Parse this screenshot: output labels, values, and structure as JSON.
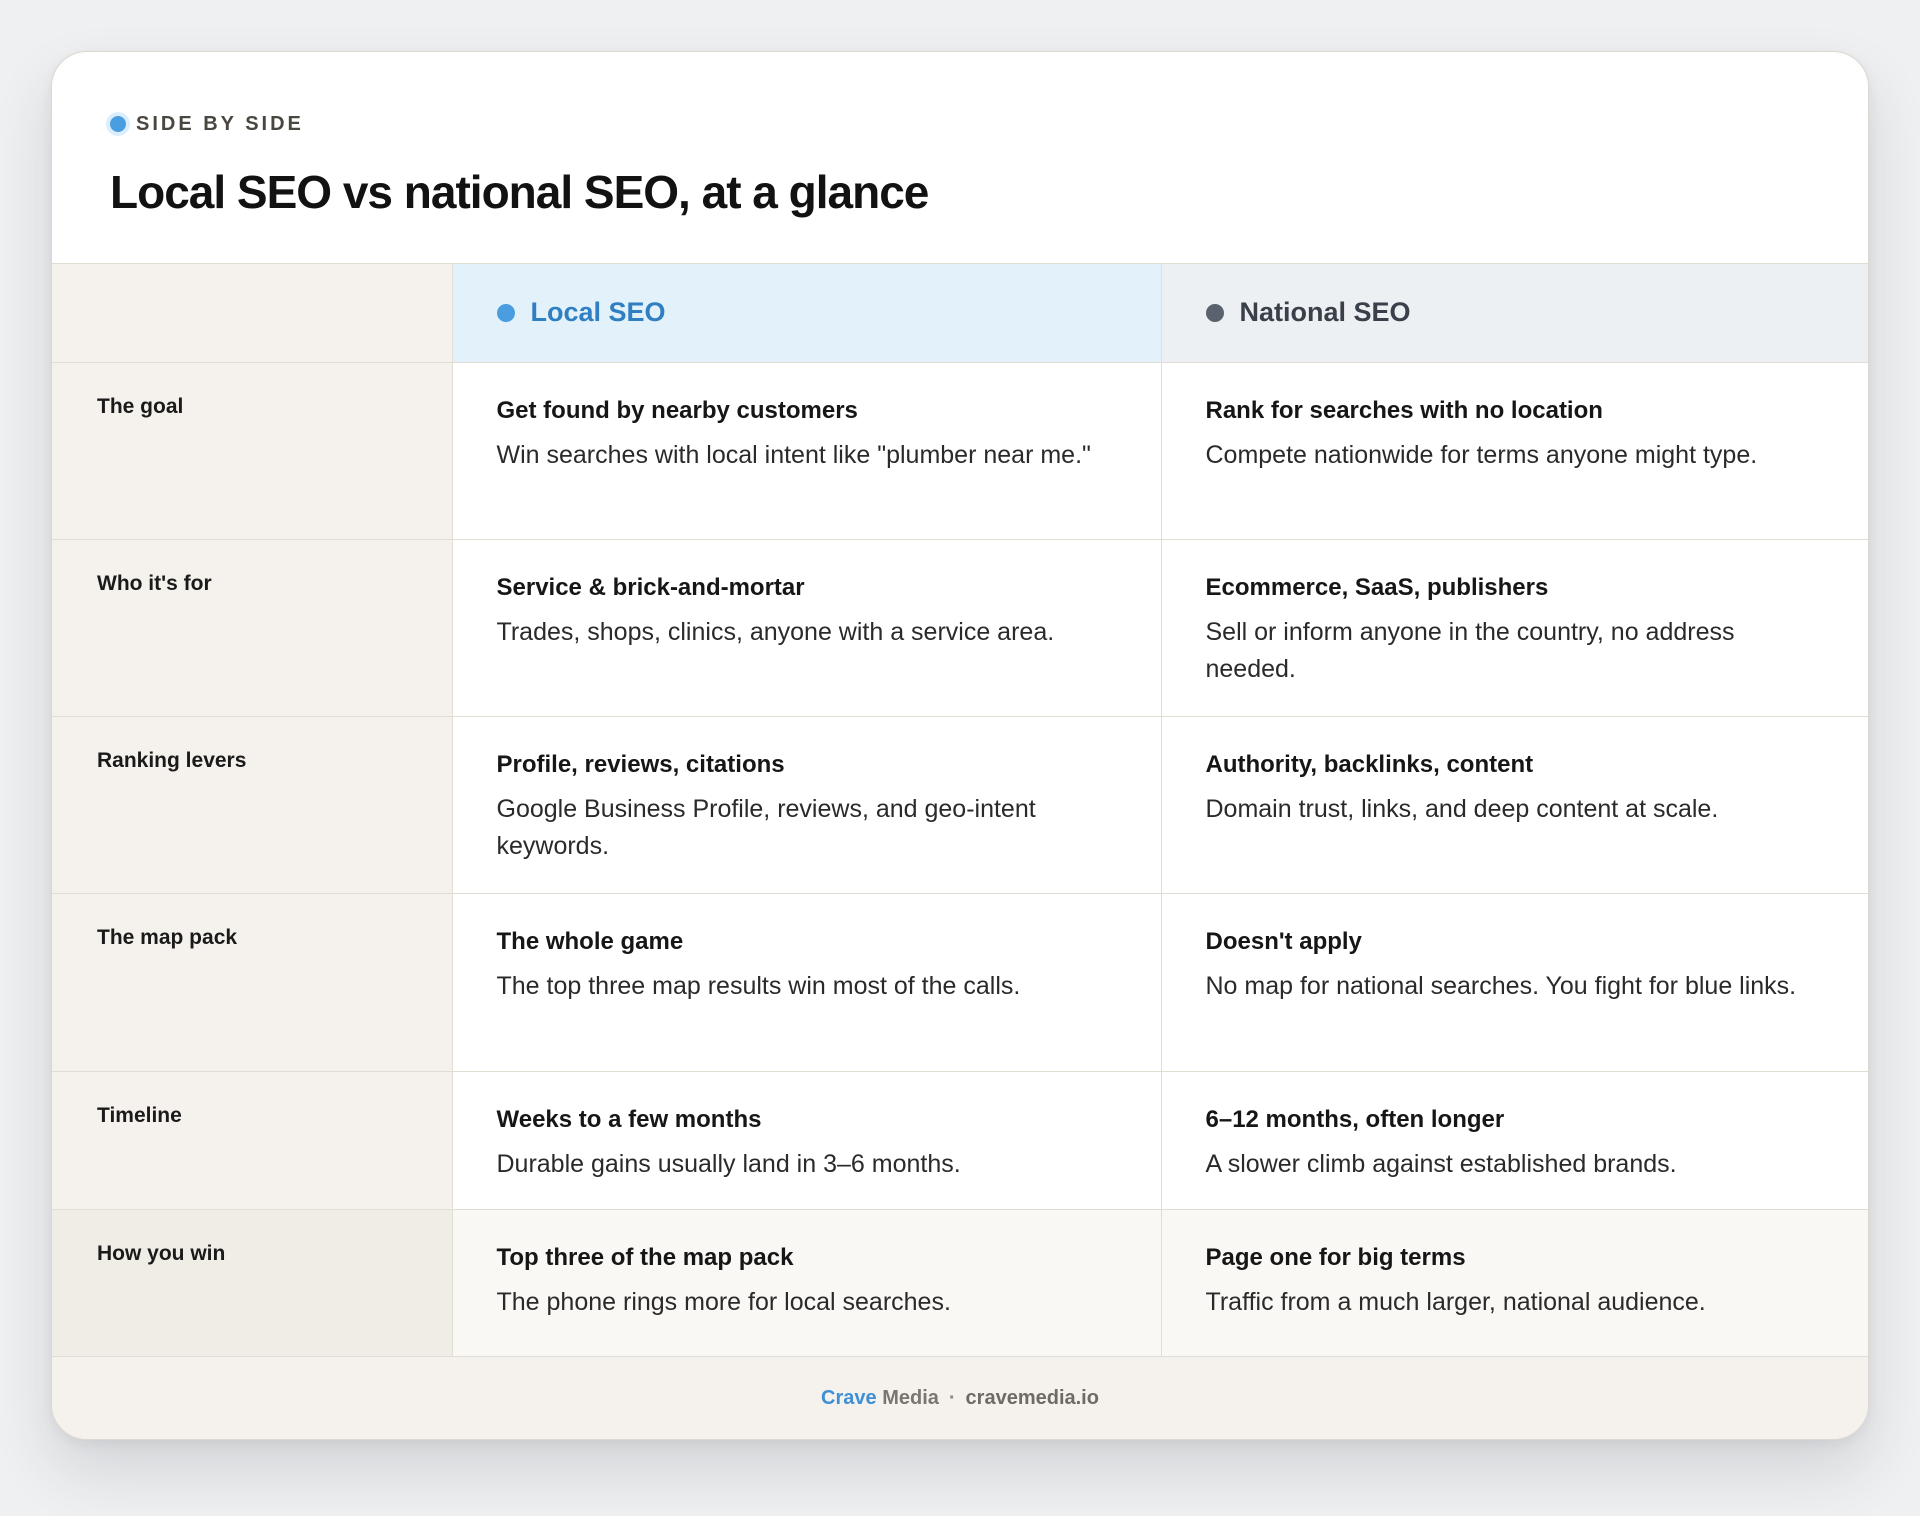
{
  "header": {
    "eyebrow": "SIDE BY SIDE",
    "title": "Local SEO vs national SEO, at a glance"
  },
  "columns": {
    "local": "Local SEO",
    "national": "National SEO"
  },
  "rows": [
    {
      "label": "The goal",
      "local_title": "Get found by nearby customers",
      "local_desc": "Win searches with local intent like \"plumber near me.\"",
      "national_title": "Rank for searches with no location",
      "national_desc": "Compete nationwide for terms anyone might type."
    },
    {
      "label": "Who it's for",
      "local_title": "Service & brick-and-mortar",
      "local_desc": "Trades, shops, clinics, anyone with a service area.",
      "national_title": "Ecommerce, SaaS, publishers",
      "national_desc": "Sell or inform anyone in the country, no address needed."
    },
    {
      "label": "Ranking levers",
      "local_title": "Profile, reviews, citations",
      "local_desc": "Google Business Profile, reviews, and geo-intent keywords.",
      "national_title": "Authority, backlinks, content",
      "national_desc": "Domain trust, links, and deep content at scale."
    },
    {
      "label": "The map pack",
      "local_title": "The whole game",
      "local_desc": "The top three map results win most of the calls.",
      "national_title": "Doesn't apply",
      "national_desc": "No map for national searches. You fight for blue links."
    },
    {
      "label": "Timeline",
      "local_title": "Weeks to a few months",
      "local_desc": "Durable gains usually land in 3–6 months.",
      "national_title": "6–12 months, often longer",
      "national_desc": "A slower climb against established brands."
    },
    {
      "label": "How you win",
      "local_title": "Top three of the map pack",
      "local_desc": "The phone rings more for local searches.",
      "national_title": "Page one for big terms",
      "national_desc": "Traffic from a much larger, national audience."
    }
  ],
  "footer": {
    "brand_primary": "Crave",
    "brand_secondary": "Media",
    "separator": "·",
    "domain": "cravemedia.io"
  },
  "colors": {
    "accent_blue": "#4a9ee0",
    "national_gray": "#5a6270",
    "label_bg": "#f5f2ed",
    "local_head_bg": "#e3f1fb"
  }
}
